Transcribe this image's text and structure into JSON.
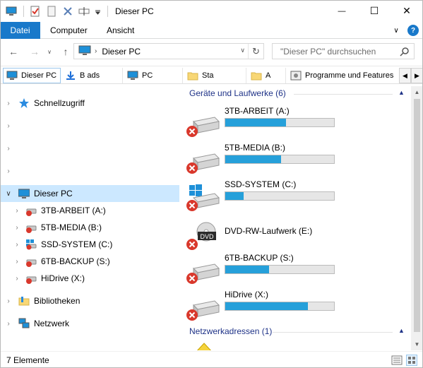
{
  "window": {
    "title": "Dieser PC",
    "minimize": "—",
    "maximize": "☐",
    "close": "✕"
  },
  "ribbon": {
    "tabs": [
      "Datei",
      "Computer",
      "Ansicht"
    ]
  },
  "address": {
    "path": "Dieser PC",
    "search_placeholder": "\"Dieser PC\" durchsuchen"
  },
  "favorites": [
    {
      "label": "Dieser PC",
      "icon": "pc-icon"
    },
    {
      "label": "B          ads",
      "icon": "download-icon"
    },
    {
      "label": "      PC",
      "icon": "pc-icon"
    },
    {
      "label": "Sta",
      "icon": "folder-icon"
    },
    {
      "label": "A",
      "icon": "folder-icon"
    },
    {
      "label": "Programme und Features",
      "icon": "programs-icon"
    }
  ],
  "nav": {
    "quick_access": "Schnellzugriff",
    "this_pc": "Dieser PC",
    "drives": [
      {
        "label": "3TB-ARBEIT (A:)",
        "icon": "drive-error-icon"
      },
      {
        "label": "5TB-MEDIA (B:)",
        "icon": "drive-error-icon"
      },
      {
        "label": "SSD-SYSTEM (C:)",
        "icon": "windows-drive-error-icon"
      },
      {
        "label": "6TB-BACKUP (S:)",
        "icon": "drive-error-icon"
      },
      {
        "label": "HiDrive (X:)",
        "icon": "drive-error-icon"
      }
    ],
    "libraries": "Bibliotheken",
    "network": "Netzwerk"
  },
  "content": {
    "group_devices": "Geräte und Laufwerke (6)",
    "group_network": "Netzwerkadressen (1)",
    "drives": [
      {
        "name": "3TB-ARBEIT (A:)",
        "used": 0.56,
        "type": "hdd"
      },
      {
        "name": "5TB-MEDIA (B:)",
        "used": 0.51,
        "type": "hdd"
      },
      {
        "name": "SSD-SYSTEM (C:)",
        "used": 0.17,
        "type": "windows"
      },
      {
        "name": "DVD-RW-Laufwerk (E:)",
        "used": null,
        "type": "dvd",
        "disc_label": "DVD"
      },
      {
        "name": "6TB-BACKUP (S:)",
        "used": 0.4,
        "type": "hdd"
      },
      {
        "name": "HiDrive (X:)",
        "used": 0.76,
        "type": "hdd"
      }
    ]
  },
  "status": {
    "count": "7 Elemente"
  },
  "colors": {
    "accent": "#1979ca",
    "bar_fill": "#26a0da",
    "selection": "#cce8ff",
    "error": "#d9382c"
  }
}
